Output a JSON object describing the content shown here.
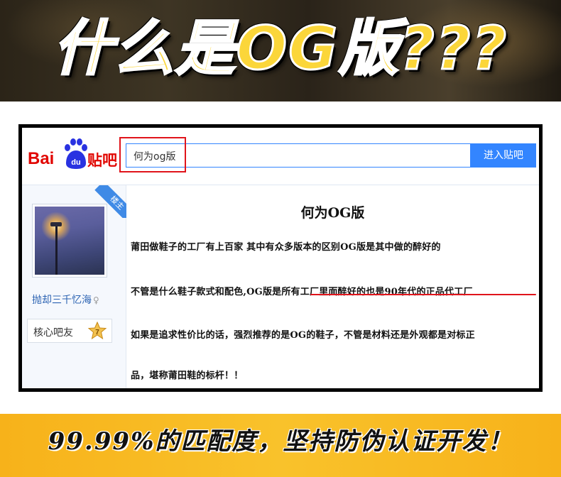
{
  "top_banner": {
    "title": "什么是OG版???"
  },
  "header": {
    "logo": {
      "bai": "Bai",
      "du": "du",
      "tieba": "贴吧"
    },
    "search": {
      "value": "何为og版"
    },
    "enter_button": "进入贴吧"
  },
  "author": {
    "ribbon": "楼主",
    "username": "抛却三千忆海",
    "gender_icon": "female-icon",
    "badge_label": "核心吧友",
    "badge_level": "7"
  },
  "post": {
    "title": "何为OG版",
    "lines": [
      "莆田做鞋子的工厂有上百家 其中有众多版本的区别OG版是其中做的醉好的",
      "不管是什么鞋子款式和配色,OG版是所有工厂里面醉好的也是90年代的正品代工厂",
      "如果是追求性价比的话，强烈推荐的是OG的鞋子，不管是材料还是外观都是对标正",
      "品，堪称莆田鞋的标杆！！"
    ]
  },
  "bottom_banner": {
    "text": "99.99%的匹配度，坚持防伪认证开发！"
  },
  "colors": {
    "accent_red": "#e0141b",
    "baidu_blue": "#3385ff",
    "banner_yellow": "#f9c22b",
    "title_yellow": "#fbd63a"
  }
}
